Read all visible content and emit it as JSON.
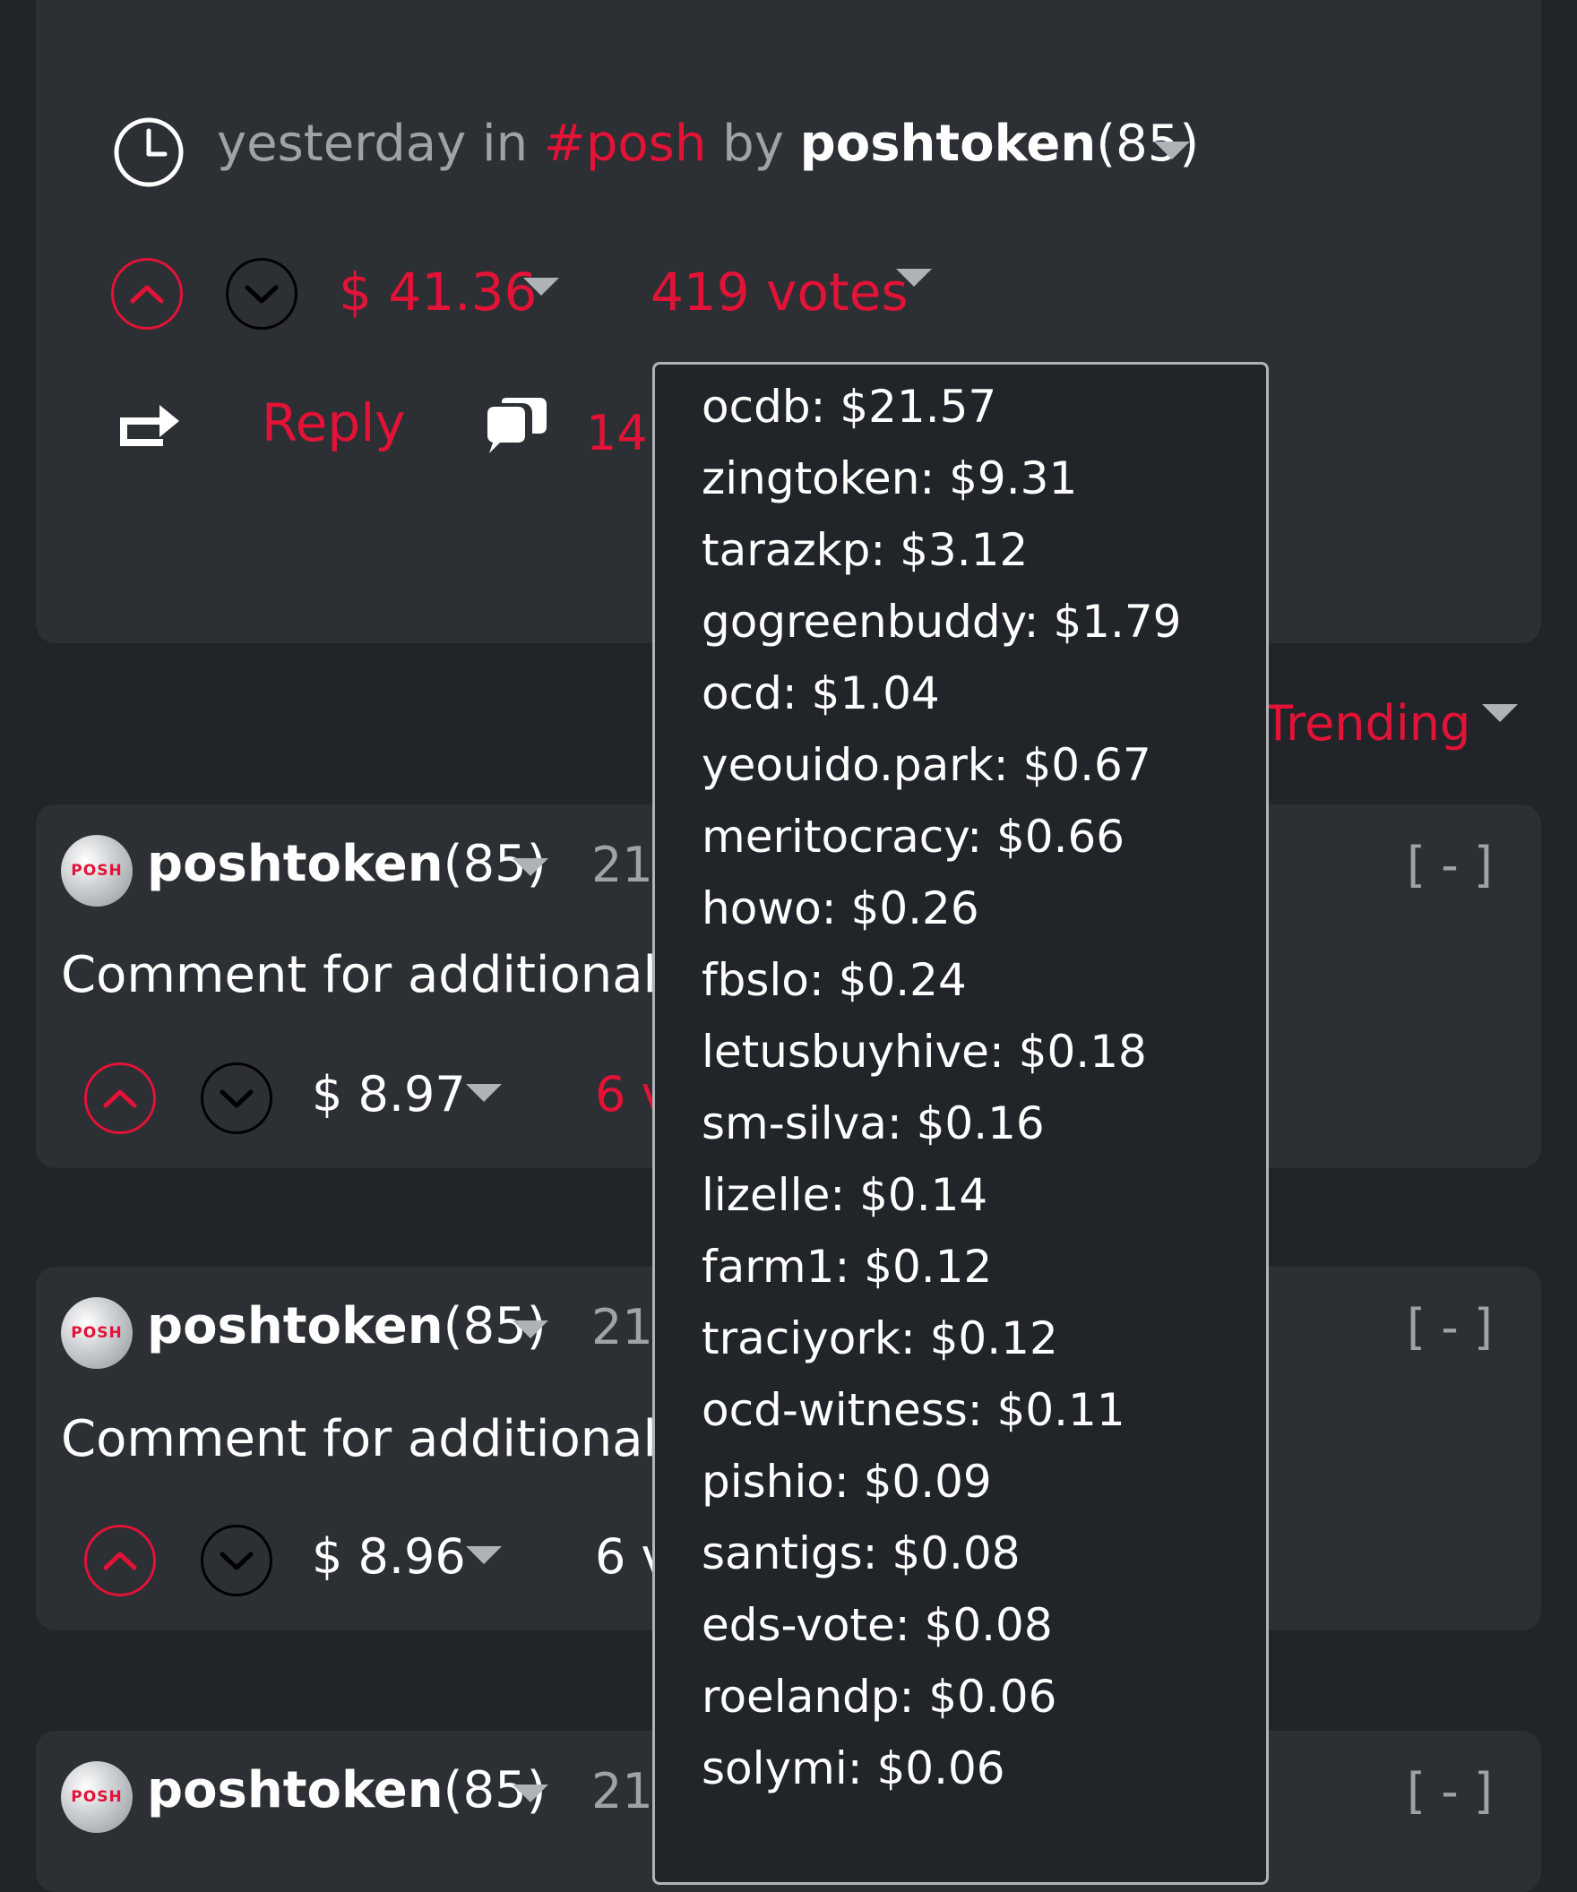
{
  "post": {
    "time": "yesterday",
    "in_text": "in",
    "tag": "#posh",
    "by_text": "by",
    "author": "poshtoken",
    "reputation": "(85)",
    "payout": "$ 41.36",
    "votes": "419 votes",
    "reply_label": "Reply",
    "comments_count": "14"
  },
  "sort": {
    "label": "Trending"
  },
  "comments": [
    {
      "author": "poshtoken",
      "reputation": "(85)",
      "time_partial": "21",
      "body": "Comment for additional f",
      "payout": "$ 8.97",
      "votes_partial": "6 v",
      "collapse": "[ - ]"
    },
    {
      "author": "poshtoken",
      "reputation": "(85)",
      "time_partial": "21",
      "body": "Comment for additional f",
      "payout": "$ 8.96",
      "votes_partial": "6 v",
      "collapse": "[ - ]"
    },
    {
      "author": "poshtoken",
      "reputation": "(85)",
      "time_partial": "21",
      "collapse": "[ - ]"
    }
  ],
  "avatar_text": "POSH",
  "voters": [
    "ocdb: $21.57",
    "zingtoken: $9.31",
    "tarazkp: $3.12",
    "gogreenbuddy: $1.79",
    "ocd: $1.04",
    "yeouido.park: $0.67",
    "meritocracy: $0.66",
    "howo: $0.26",
    "fbslo: $0.24",
    "letusbuyhive: $0.18",
    "sm-silva: $0.16",
    "lizelle: $0.14",
    "farm1: $0.12",
    "traciyork: $0.12",
    "ocd-witness: $0.11",
    "pishio: $0.09",
    "santigs: $0.08",
    "eds-vote: $0.08",
    "roelandp: $0.06",
    "solymi: $0.06"
  ],
  "colors": {
    "background": "#212428",
    "card": "#2c2f33",
    "accent_red": "#e31337",
    "muted_gray": "#9ea3a8",
    "text_white": "#ffffff"
  }
}
